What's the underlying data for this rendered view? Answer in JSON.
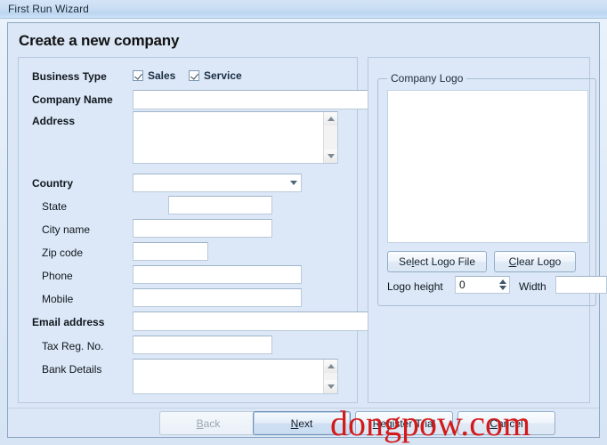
{
  "window": {
    "title": "First Run Wizard"
  },
  "page": {
    "title": "Create a new company"
  },
  "form": {
    "business_type": {
      "label": "Business Type",
      "options": [
        {
          "label": "Sales",
          "checked": true
        },
        {
          "label": "Service",
          "checked": true
        }
      ]
    },
    "fields": [
      {
        "label": "Company Name",
        "bold": true,
        "value": "",
        "type": "text"
      },
      {
        "label": "Address",
        "bold": true,
        "value": "",
        "type": "textarea"
      },
      {
        "label": "Country",
        "bold": true,
        "value": "",
        "type": "combo"
      },
      {
        "label": "State",
        "bold": false,
        "value": "",
        "type": "text"
      },
      {
        "label": "City name",
        "bold": false,
        "value": "",
        "type": "text"
      },
      {
        "label": "Zip code",
        "bold": false,
        "value": "",
        "type": "text"
      },
      {
        "label": "Phone",
        "bold": false,
        "value": "",
        "type": "text"
      },
      {
        "label": "Mobile",
        "bold": false,
        "value": "",
        "type": "text"
      },
      {
        "label": "Email address",
        "bold": true,
        "value": "",
        "type": "text"
      },
      {
        "label": "Tax Reg. No.",
        "bold": false,
        "value": "",
        "type": "text"
      },
      {
        "label": "Bank Details",
        "bold": false,
        "value": "",
        "type": "textarea"
      }
    ]
  },
  "logo": {
    "group_title": "Company Logo",
    "select_button": "Select Logo File",
    "select_button_mnemonic": "L",
    "clear_button": "Clear Logo",
    "clear_button_mnemonic": "C",
    "height_label": "Logo height",
    "height_value": "0",
    "width_label": "Width",
    "width_value": ""
  },
  "footer": {
    "back": "Back",
    "back_mnemonic": "B",
    "back_disabled": true,
    "next": "Next",
    "next_mnemonic": "N",
    "register_trial": "Register Trial",
    "register_trial_mnemonic": "R",
    "cancel": "Cancel",
    "cancel_mnemonic": "C"
  },
  "watermark": {
    "text": "dongpow.com",
    "color": "#d21a1a"
  }
}
